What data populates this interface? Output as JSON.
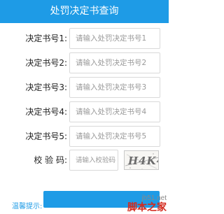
{
  "header": {
    "title": "处罚决定书查询"
  },
  "form": {
    "fields": [
      {
        "label": "决定书号1:",
        "placeholder": "请输入处罚决定书号1",
        "value": ""
      },
      {
        "label": "决定书号2:",
        "placeholder": "请输入处罚决定书号2",
        "value": ""
      },
      {
        "label": "决定书号3:",
        "placeholder": "请输入处罚决定书号3",
        "value": ""
      },
      {
        "label": "决定书号4:",
        "placeholder": "请输入处罚决定书号4",
        "value": ""
      },
      {
        "label": "决定书号5:",
        "placeholder": "请输入处罚决定书号5",
        "value": ""
      }
    ],
    "captcha": {
      "label": "校 验 码:",
      "placeholder": "请输入校验码",
      "value": "",
      "image_text": "H4K4"
    },
    "query_button": ""
  },
  "tip": {
    "label": "温馨提示:"
  },
  "watermark": {
    "url": "jb51.net",
    "site": "脚本之家"
  },
  "colors": {
    "accent": "#1e9be6",
    "watermark": "#d32a1e"
  }
}
